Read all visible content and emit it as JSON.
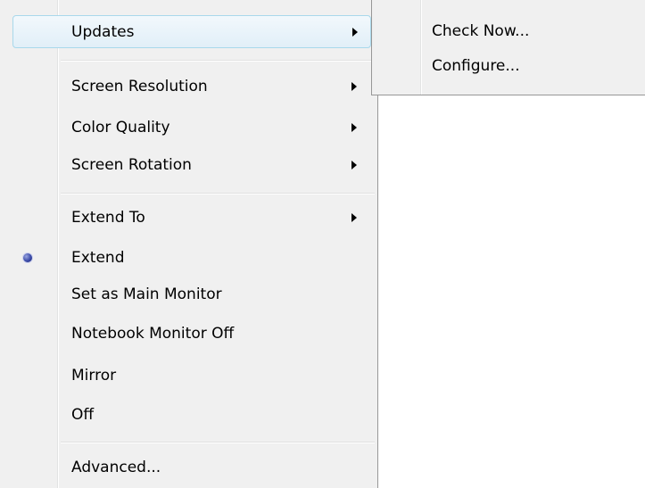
{
  "main_menu": {
    "items": [
      {
        "label": "Updates",
        "has_submenu": true,
        "highlighted": true
      },
      {
        "label": "Screen Resolution",
        "has_submenu": true
      },
      {
        "label": "Color Quality",
        "has_submenu": true
      },
      {
        "label": "Screen Rotation",
        "has_submenu": true
      },
      {
        "label": "Extend To",
        "has_submenu": true
      },
      {
        "label": "Extend",
        "checked": true
      },
      {
        "label": "Set as Main Monitor"
      },
      {
        "label": "Notebook Monitor Off"
      },
      {
        "label": "Mirror"
      },
      {
        "label": "Off"
      },
      {
        "label": "Advanced..."
      }
    ]
  },
  "submenu": {
    "parent": "Updates",
    "items": [
      {
        "label": "Check Now..."
      },
      {
        "label": "Configure..."
      }
    ]
  },
  "colors": {
    "menu_background": "#f0f0f0",
    "highlight_border": "#a8d8eb",
    "radio_dot": "#3a4aa8"
  }
}
